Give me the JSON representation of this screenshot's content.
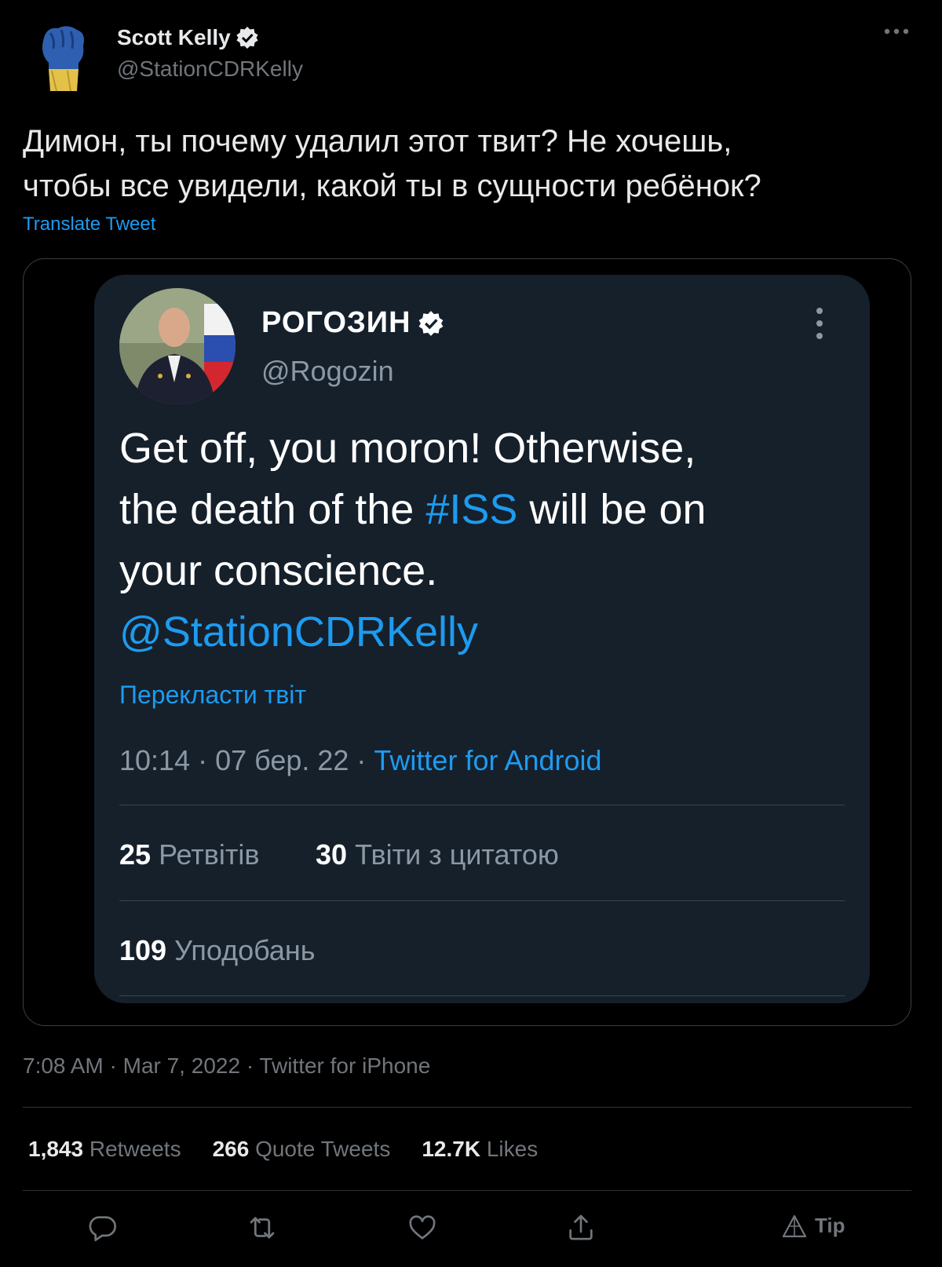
{
  "author": {
    "name": "Scott Kelly",
    "handle": "@StationCDRKelly"
  },
  "tweet": {
    "text_line1": "Димон, ты почему удалил этот твит? Не хочешь,",
    "text_line2": "чтобы все увидели, какой ты в сущности ребёнок?",
    "translate_label": "Translate Tweet"
  },
  "embedded_tweet": {
    "name": "РОГОЗИН",
    "handle": "@Rogozin",
    "text_part1": "Get off, you moron!  Otherwise,",
    "text_part2": "the death of the ",
    "hashtag": "#ISS",
    "text_part3": " will be on",
    "text_part4": "your conscience.",
    "mention": "@StationCDRKelly",
    "translate_label": "Перекласти твіт",
    "time_date": "10:14 · 07 бер. 22 · ",
    "source": "Twitter for Android",
    "retweets_count": "25",
    "retweets_label": "Ретвітів",
    "quotes_count": "30",
    "quotes_label": "Твіти з цитатою",
    "likes_count": "109",
    "likes_label": "Уподобань"
  },
  "meta": {
    "timestamp": "7:08 AM · Mar 7, 2022 · Twitter for iPhone"
  },
  "stats": {
    "retweets_count": "1,843",
    "retweets_label": "Retweets",
    "quotes_count": "266",
    "quotes_label": "Quote Tweets",
    "likes_count": "12.7K",
    "likes_label": "Likes"
  },
  "actions": {
    "tip_label": "Tip"
  },
  "icons": [
    "verified-badge-icon",
    "more-icon",
    "reply-icon",
    "retweet-icon",
    "like-icon",
    "share-icon",
    "tip-icon"
  ],
  "colors": {
    "background": "#000000",
    "accent": "#1d9bf0",
    "muted": "#71767b",
    "embedded_card": "#15202b"
  }
}
